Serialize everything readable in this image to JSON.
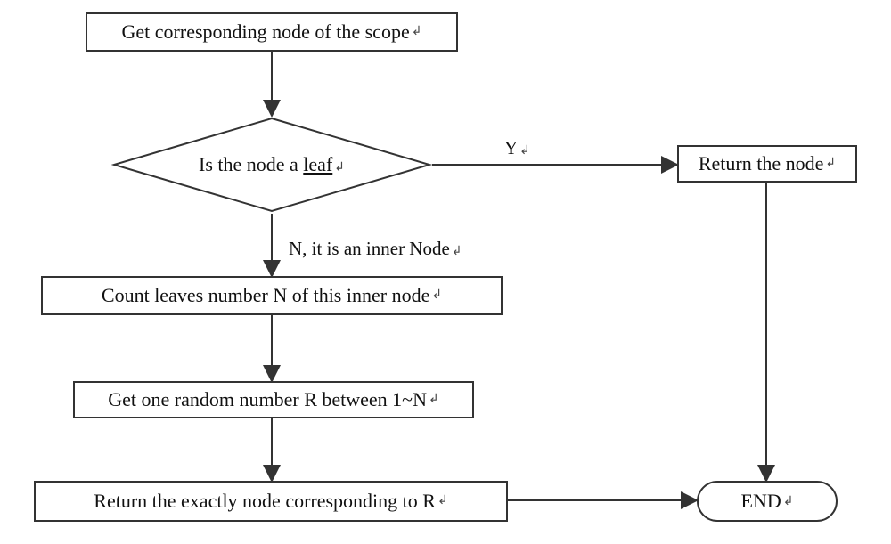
{
  "flowchart": {
    "nodes": {
      "start": "Get corresponding node of the scope",
      "decision_pre": "Is the node a ",
      "decision_leaf": "leaf",
      "count": "Count leaves number N of this inner node ",
      "random": "Get one random number R between 1~N",
      "return_r": "Return the exactly node corresponding to R",
      "return_node": "Return the node",
      "end": "END"
    },
    "labels": {
      "yes": "Y",
      "no": "N, it is an inner Node"
    },
    "marker_glyph": "↲"
  },
  "chart_data": {
    "type": "flowchart",
    "title": "",
    "nodes": [
      {
        "id": "start",
        "type": "process",
        "text": "Get corresponding node of the scope"
      },
      {
        "id": "decision",
        "type": "decision",
        "text": "Is the node a leaf"
      },
      {
        "id": "count",
        "type": "process",
        "text": "Count leaves number N of this inner node"
      },
      {
        "id": "random",
        "type": "process",
        "text": "Get one random number R between 1~N"
      },
      {
        "id": "return_r",
        "type": "process",
        "text": "Return the exactly node corresponding to R"
      },
      {
        "id": "return_node",
        "type": "process",
        "text": "Return the node"
      },
      {
        "id": "end",
        "type": "terminal",
        "text": "END"
      }
    ],
    "edges": [
      {
        "from": "start",
        "to": "decision",
        "label": ""
      },
      {
        "from": "decision",
        "to": "return_node",
        "label": "Y"
      },
      {
        "from": "decision",
        "to": "count",
        "label": "N, it is an inner Node"
      },
      {
        "from": "count",
        "to": "random",
        "label": ""
      },
      {
        "from": "random",
        "to": "return_r",
        "label": ""
      },
      {
        "from": "return_r",
        "to": "end",
        "label": ""
      },
      {
        "from": "return_node",
        "to": "end",
        "label": ""
      }
    ]
  }
}
